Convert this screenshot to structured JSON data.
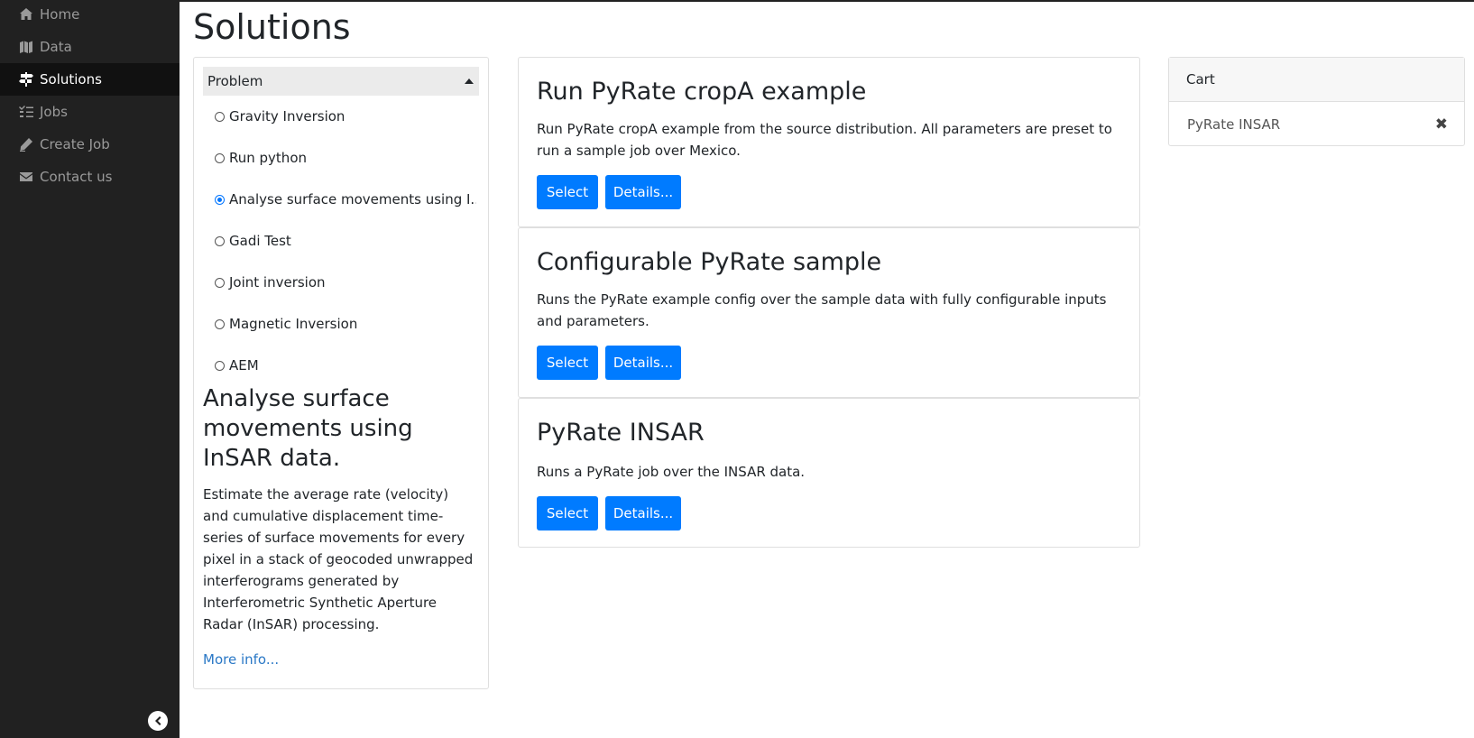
{
  "sidebar": {
    "items": [
      {
        "label": "Home",
        "icon": "home-icon"
      },
      {
        "label": "Data",
        "icon": "map-icon"
      },
      {
        "label": "Solutions",
        "icon": "signs-icon",
        "active": true
      },
      {
        "label": "Jobs",
        "icon": "tasks-icon"
      },
      {
        "label": "Create Job",
        "icon": "edit-icon"
      },
      {
        "label": "Contact us",
        "icon": "envelope-icon"
      }
    ],
    "collapse_icon": "chevron-left-icon"
  },
  "page": {
    "title": "Solutions"
  },
  "problem": {
    "header_label": "Problem",
    "options": [
      {
        "label": "Gravity Inversion",
        "checked": false
      },
      {
        "label": "Run python",
        "checked": false
      },
      {
        "label": "Analyse surface movements using I...",
        "checked": true
      },
      {
        "label": "Gadi Test",
        "checked": false
      },
      {
        "label": "Joint inversion",
        "checked": false
      },
      {
        "label": "Magnetic Inversion",
        "checked": false
      },
      {
        "label": "AEM",
        "checked": false
      }
    ],
    "selected_title": "Analyse surface movements using InSAR data.",
    "selected_description": "Estimate the average rate (velocity) and cumulative displacement time-series of surface movements for every pixel in a stack of geocoded unwrapped interferograms generated by Interferometric Synthetic Aperture Radar (InSAR) processing.",
    "more_info_label": "More info..."
  },
  "solutions": [
    {
      "title": "Run PyRate cropA example",
      "description": "Run PyRate cropA example from the source distribution. All parameters are preset to run a sample job over Mexico.",
      "select_label": "Select",
      "details_label": "Details..."
    },
    {
      "title": "Configurable PyRate sample",
      "description": "Runs the PyRate example config over the sample data with fully configurable inputs and parameters.",
      "select_label": "Select",
      "details_label": "Details..."
    },
    {
      "title": "PyRate INSAR",
      "description": "Runs a PyRate job over the INSAR data.",
      "select_label": "Select",
      "details_label": "Details..."
    }
  ],
  "cart": {
    "header": "Cart",
    "items": [
      {
        "label": "PyRate INSAR"
      }
    ],
    "remove_symbol": "✖"
  },
  "colors": {
    "sidebar_bg": "#212121",
    "primary": "#007bff",
    "link": "#2a78c6"
  }
}
